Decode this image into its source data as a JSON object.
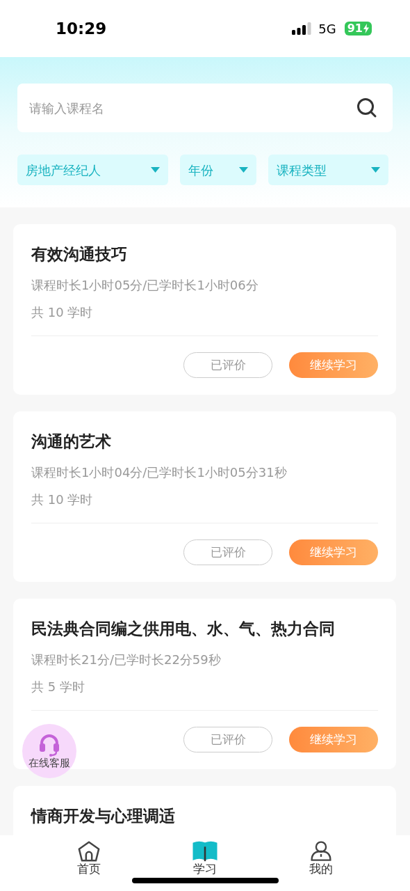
{
  "status_bar": {
    "time": "10:29",
    "network": "5G",
    "battery": "91"
  },
  "search": {
    "placeholder": "请输入课程名"
  },
  "filters": [
    {
      "label": "房地产经纪人"
    },
    {
      "label": "年份"
    },
    {
      "label": "课程类型"
    }
  ],
  "courses": [
    {
      "title": "有效沟通技巧",
      "duration": "课程时长1小时05分/已学时长1小时06分",
      "hours": "共 10 学时",
      "actions": [
        "已评价",
        "继续学习"
      ]
    },
    {
      "title": "沟通的艺术",
      "duration": "课程时长1小时04分/已学时长1小时05分31秒",
      "hours": "共 10 学时",
      "actions": [
        "已评价",
        "继续学习"
      ]
    },
    {
      "title": "民法典合同编之供用电、水、气、热力合同",
      "duration": "课程时长21分/已学时长22分59秒",
      "hours": "共 5 学时",
      "actions": [
        "已评价",
        "继续学习"
      ]
    },
    {
      "title": "情商开发与心理调适"
    }
  ],
  "floating_button": {
    "label": "在线客服"
  },
  "tabs": [
    {
      "kind": "home",
      "label": "首页",
      "selected": false
    },
    {
      "kind": "study",
      "label": "学习",
      "selected": true
    },
    {
      "kind": "profile",
      "label": "我的",
      "selected": false
    }
  ]
}
